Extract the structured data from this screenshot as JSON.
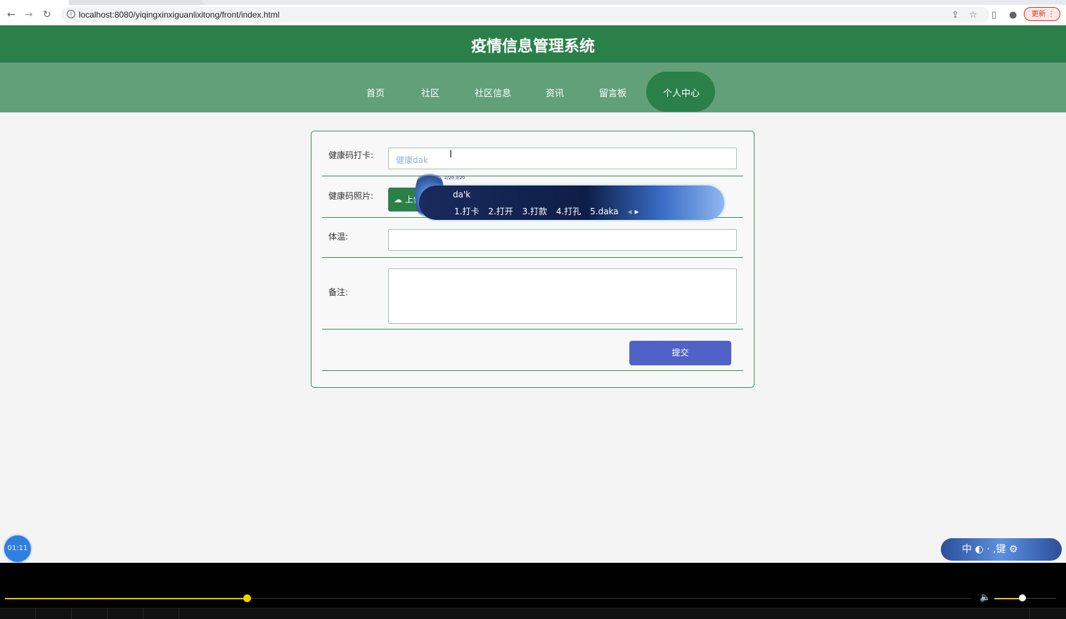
{
  "browser": {
    "url": "localhost:8080/yiqingxinxiguanlixitong/front/index.html",
    "update_label": "更新"
  },
  "site": {
    "title": "疫情信息管理系统",
    "nav": [
      "首页",
      "社区",
      "社区信息",
      "资讯",
      "留言板",
      "个人中心"
    ],
    "active_nav": "个人中心"
  },
  "form": {
    "health_checkin_label": "健康码打卡:",
    "health_checkin_value": "健康dak",
    "health_photo_label": "健康码照片:",
    "upload_label": "上传",
    "temperature_label": "体温:",
    "remark_label": "备注:",
    "submit_label": "提交"
  },
  "ime": {
    "composition": "da'k",
    "candidates": [
      "1.打卡",
      "2.打开",
      "3.打款",
      "4.打孔",
      "5.daka"
    ],
    "tray": "中 ◐ · ,键 ⚙",
    "date": "2/20-3/20"
  },
  "video": {
    "timer": "01:11",
    "progress": 0.25,
    "volume": 0.45
  },
  "colors": {
    "header_green": "#2a8048",
    "nav_green": "#62a07a",
    "submit_blue": "#5062c5"
  }
}
